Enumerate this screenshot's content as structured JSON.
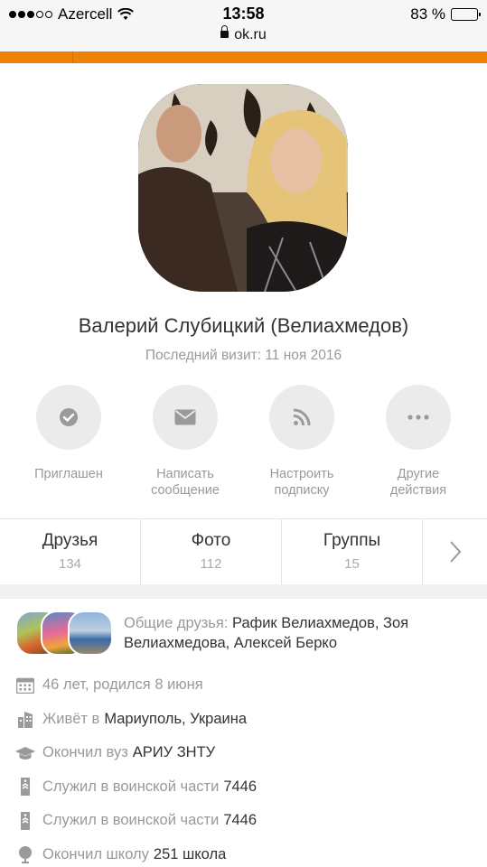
{
  "status": {
    "carrier": "Azercell",
    "time": "13:58",
    "url": "ok.ru",
    "battery": "83 %",
    "battery_level": 0.83,
    "signal_dots_filled": 3,
    "signal_dots_total": 5
  },
  "profile": {
    "name": "Валерий Слубицкий (Велиахмедов)",
    "last_visit": "Последний визит: 11 ноя 2016"
  },
  "actions": [
    {
      "label": "Приглашен",
      "icon": "check-icon"
    },
    {
      "label": "Написать сообщение",
      "icon": "envelope-icon"
    },
    {
      "label": "Настроить подписку",
      "icon": "rss-icon"
    },
    {
      "label": "Другие действия",
      "icon": "more-dots-icon"
    }
  ],
  "tabs": [
    {
      "title": "Друзья",
      "count": "134"
    },
    {
      "title": "Фото",
      "count": "112"
    },
    {
      "title": "Группы",
      "count": "15"
    }
  ],
  "common_friends": {
    "prefix": "Общие друзья:",
    "names": "Рафик Велиахмедов, Зоя Велиахмедова, Алексей Берко"
  },
  "info": [
    {
      "icon": "calendar-icon",
      "muted": "",
      "value": "46 лет, родился 8 июня",
      "value_muted": true
    },
    {
      "icon": "building-icon",
      "muted": "Живёт в",
      "value": "Мариуполь, Украина",
      "value_muted": false
    },
    {
      "icon": "graduation-cap-icon",
      "muted": "Окончил вуз",
      "value": "АРИУ ЗНТУ",
      "value_muted": false
    },
    {
      "icon": "military-icon",
      "muted": "Служил в воинской части",
      "value": "7446",
      "value_muted": false
    },
    {
      "icon": "military-icon",
      "muted": "Служил в воинской части",
      "value": "7446",
      "value_muted": false
    },
    {
      "icon": "globe-icon",
      "muted": "Окончил школу",
      "value": "251 школа",
      "value_muted": false
    }
  ],
  "colors": {
    "accent": "#ee8208",
    "muted_text": "#999999",
    "icon_gray": "#9a9a9a",
    "circle_bg": "#ebebeb"
  }
}
